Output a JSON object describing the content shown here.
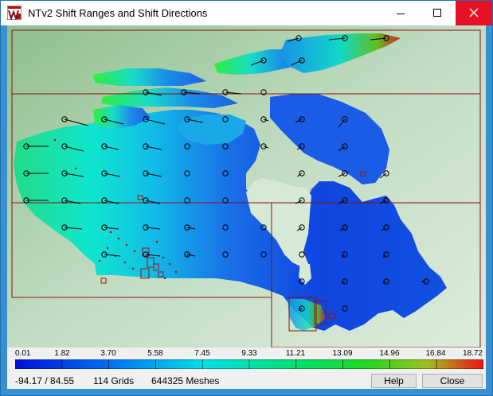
{
  "window": {
    "title": "NTv2 Shift Ranges and Shift Directions"
  },
  "icons": {
    "app": "survey-logo-icon",
    "minimize": "minimize-icon",
    "maximize": "maximize-icon",
    "close": "close-icon"
  },
  "scale": {
    "labels": [
      "0.01",
      "1.82",
      "3.70",
      "5.58",
      "7.45",
      "9.33",
      "11.21",
      "13.09",
      "14.96",
      "16.84",
      "18.72"
    ]
  },
  "status": {
    "lat_range": "-94.17 / 84.55",
    "grids": "114 Grids",
    "meshes": "644325 Meshes"
  },
  "buttons": {
    "help": "Help",
    "close": "Close"
  },
  "colors": {
    "title_close_bg": "#e81123",
    "grid_lines": "#8b1010"
  }
}
